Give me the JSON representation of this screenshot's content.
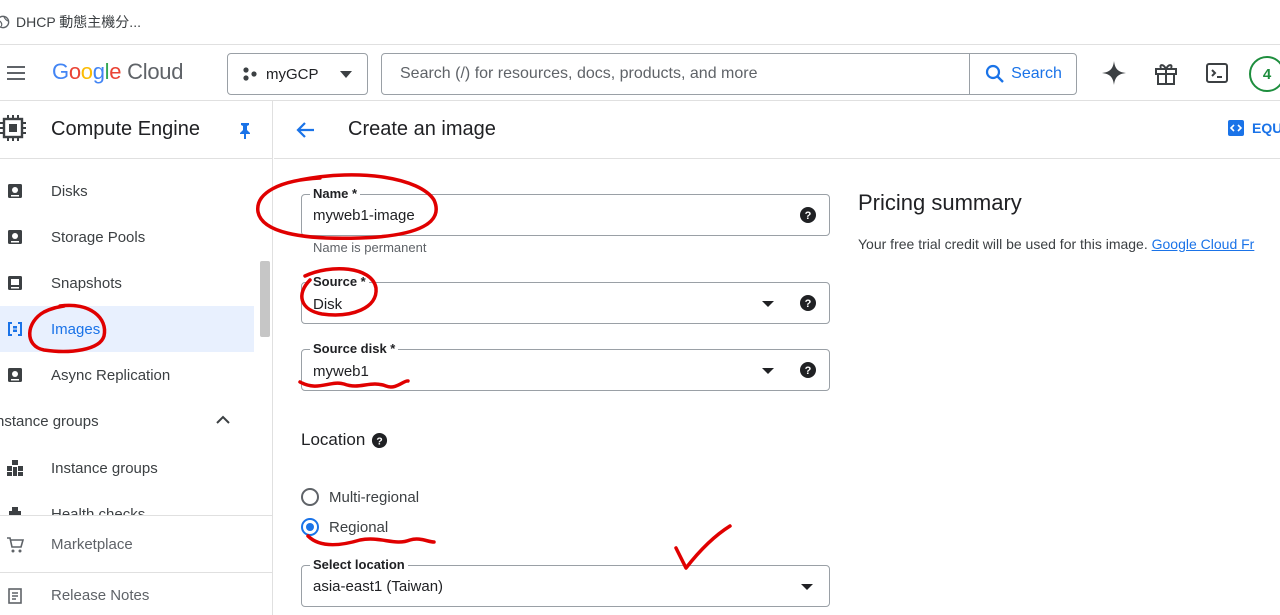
{
  "browser": {
    "tab_title": "DHCP 動態主機分..."
  },
  "topbar": {
    "logo_letters": [
      "G",
      "o",
      "o",
      "g",
      "l",
      "e"
    ],
    "logo_cloud": "Cloud",
    "project": "myGCP",
    "search_placeholder": "Search (/) for resources, docs, products, and more",
    "search_button": "Search",
    "avatar_badge": "4"
  },
  "sidebar": {
    "product_title": "Compute Engine",
    "items": [
      {
        "label": "Disks",
        "icon": "disk-icon"
      },
      {
        "label": "Storage Pools",
        "icon": "disk-icon"
      },
      {
        "label": "Snapshots",
        "icon": "snapshot-icon"
      },
      {
        "label": "Images",
        "icon": "images-icon",
        "active": true
      },
      {
        "label": "Async Replication",
        "icon": "disk-icon"
      }
    ],
    "group_header": "nstance groups",
    "group_items": [
      {
        "label": "Instance groups",
        "icon": "instance-groups-icon"
      },
      {
        "label": "Health checks",
        "icon": "health-checks-icon"
      }
    ],
    "bottom": [
      {
        "label": "Marketplace",
        "icon": "cart-icon"
      },
      {
        "label": "Release Notes",
        "icon": "notes-icon"
      }
    ]
  },
  "header": {
    "title": "Create an image",
    "equiv_label": "EQU"
  },
  "form": {
    "name": {
      "label": "Name *",
      "value": "myweb1-image",
      "hint": "Name is permanent"
    },
    "source": {
      "label": "Source *",
      "value": "Disk"
    },
    "source_disk": {
      "label": "Source disk *",
      "value": "myweb1"
    },
    "location": {
      "title": "Location",
      "options": [
        {
          "label": "Multi-regional",
          "checked": false
        },
        {
          "label": "Regional",
          "checked": true
        }
      ]
    },
    "select_location": {
      "label": "Select location",
      "value": "asia-east1 (Taiwan)"
    }
  },
  "pricing": {
    "title": "Pricing summary",
    "text": "Your free trial credit will be used for this image.",
    "link": "Google Cloud Fr"
  },
  "colors": {
    "accent": "#1a73e8",
    "annotation": "#e00000",
    "active_bg": "#e8f0fe"
  }
}
